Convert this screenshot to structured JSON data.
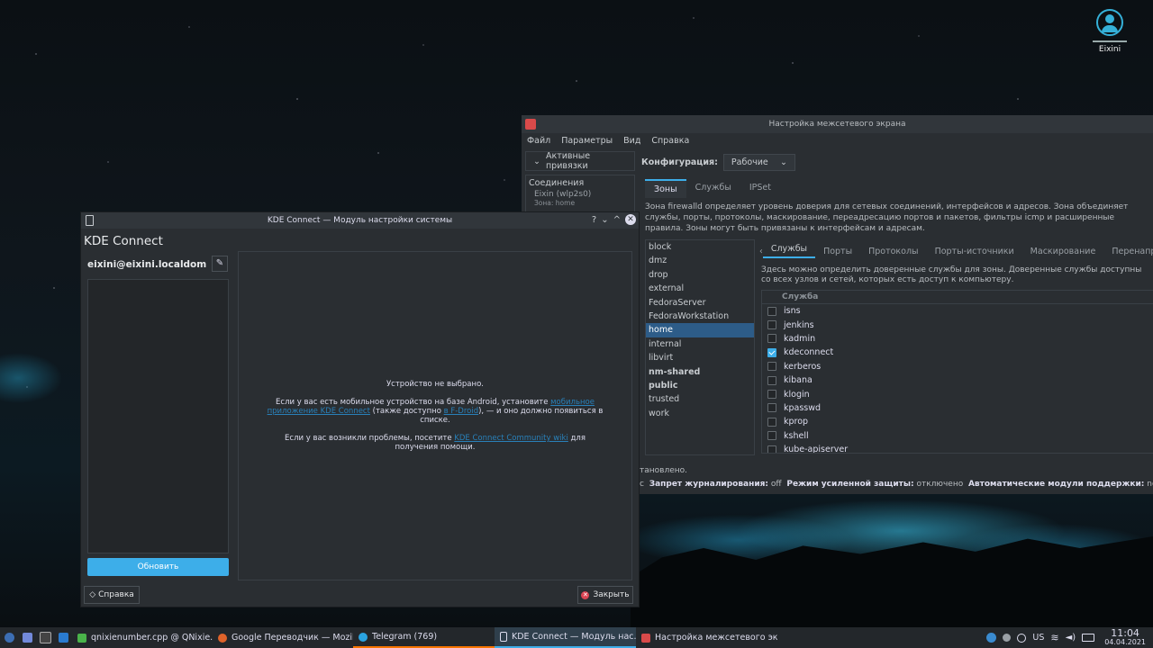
{
  "desktop": {
    "user_name": "Eixini"
  },
  "firewall": {
    "title": "Настройка межсетевого экрана",
    "menu": [
      "Файл",
      "Параметры",
      "Вид",
      "Справка"
    ],
    "active_bindings": "Активные привязки",
    "connections": {
      "header": "Соединения",
      "item": "Eixin (wlp2s0)",
      "zone": "Зона: home"
    },
    "config_label": "Конфигурация:",
    "config_value": "Рабочие",
    "tabs": [
      "Зоны",
      "Службы",
      "IPSet"
    ],
    "zone_desc": "Зона firewalld  определяет уровень доверия для сетевых соединений, интерфейсов и адресов. Зона объединяет службы, порты, протоколы, маскирование, переадресацию портов и пакетов, фильтры icmp и расширенные правила. Зоны могут быть привязаны к интерфейсам и адресам.",
    "zones": [
      "block",
      "dmz",
      "drop",
      "external",
      "FedoraServer",
      "FedoraWorkstation",
      "home",
      "internal",
      "libvirt",
      "nm-shared",
      "public",
      "trusted",
      "work"
    ],
    "subtabs": [
      "Службы",
      "Порты",
      "Протоколы",
      "Порты-источники",
      "Маскирование",
      "Перенаправление"
    ],
    "services_desc": "Здесь можно определить доверенные службы для зоны. Доверенные службы доступны со всех узлов и сетей, которых есть доступ к компьютеру.",
    "services_header": "Служба",
    "services": [
      {
        "name": "isns",
        "checked": false
      },
      {
        "name": "jenkins",
        "checked": false
      },
      {
        "name": "kadmin",
        "checked": false
      },
      {
        "name": "kdeconnect",
        "checked": true
      },
      {
        "name": "kerberos",
        "checked": false
      },
      {
        "name": "kibana",
        "checked": false
      },
      {
        "name": "klogin",
        "checked": false
      },
      {
        "name": "kpasswd",
        "checked": false
      },
      {
        "name": "kprop",
        "checked": false
      },
      {
        "name": "kshell",
        "checked": false
      },
      {
        "name": "kube-apiserver",
        "checked": false
      }
    ],
    "status_line": "тановлено.",
    "status": {
      "prefix": "с",
      "log_label": "Запрет журналирования:",
      "log_value": "off",
      "lock_label": "Режим усиленной защиты:",
      "lock_value": "отключено",
      "helpers_label": "Автоматические модули поддержки:",
      "helpers_value": "no"
    }
  },
  "kdeconnect": {
    "title": "KDE Connect — Модуль настройки системы",
    "title_btns": [
      "?",
      "⌄",
      "^"
    ],
    "app_title": "KDE Connect",
    "host": "eixini@eixini.localdom",
    "refresh": "Обновить",
    "no_device": "Устройство не выбрано.",
    "android_1": "Если у вас есть мобильное устройство на базе Android, установите ",
    "android_link1": "мобильное приложение KDE Connect",
    "android_2": " (также доступно ",
    "android_link2": "в F-Droid",
    "android_3": "), — и оно должно появиться в списке.",
    "issues_1": "Если у вас возникли проблемы, посетите ",
    "issues_link": "KDE Connect Community wiki",
    "issues_2": " для получения помощи.",
    "help": "Справка",
    "close": "Закрыть"
  },
  "taskbar": {
    "tasks": [
      "qnixienumber.cpp @ QNixie...",
      "Google Переводчик — Mozil...",
      "Telegram (769)",
      "KDE Connect — Модуль нас...",
      "Настройка межсетевого эк..."
    ],
    "kbd": "US",
    "time": "11:04",
    "date": "04.04.2021"
  },
  "colors": {
    "accent": "#3daee9",
    "selection": "#2d5c88",
    "window": "#2a2e32",
    "titlebar": "#31363b",
    "danger": "#da4453"
  }
}
